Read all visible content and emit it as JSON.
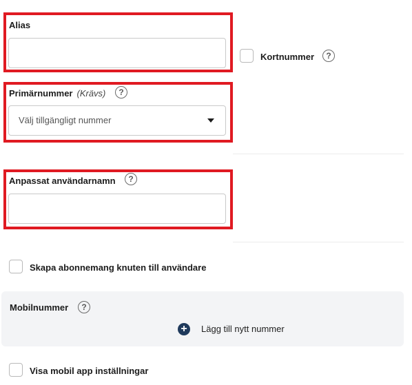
{
  "alias": {
    "label": "Alias",
    "value": ""
  },
  "short_number": {
    "label": "Kortnummer",
    "help": "?"
  },
  "primary_number": {
    "label": "Primärnummer",
    "required": "(Krävs)",
    "help": "?",
    "placeholder": "Välj tillgängligt nummer"
  },
  "custom_username": {
    "label": "Anpassat användarnamn",
    "help": "?",
    "value": ""
  },
  "subscription": {
    "label": "Skapa abonnemang knuten till användare"
  },
  "mobile": {
    "label": "Mobilnummer",
    "help": "?",
    "add_label": "Lägg till nytt nummer",
    "add_symbol": "+"
  },
  "mobile_app": {
    "label": "Visa mobil app inställningar"
  },
  "colors": {
    "highlight": "#e01a22",
    "accent": "#1f3a5c",
    "panel": "#f3f4f6"
  }
}
